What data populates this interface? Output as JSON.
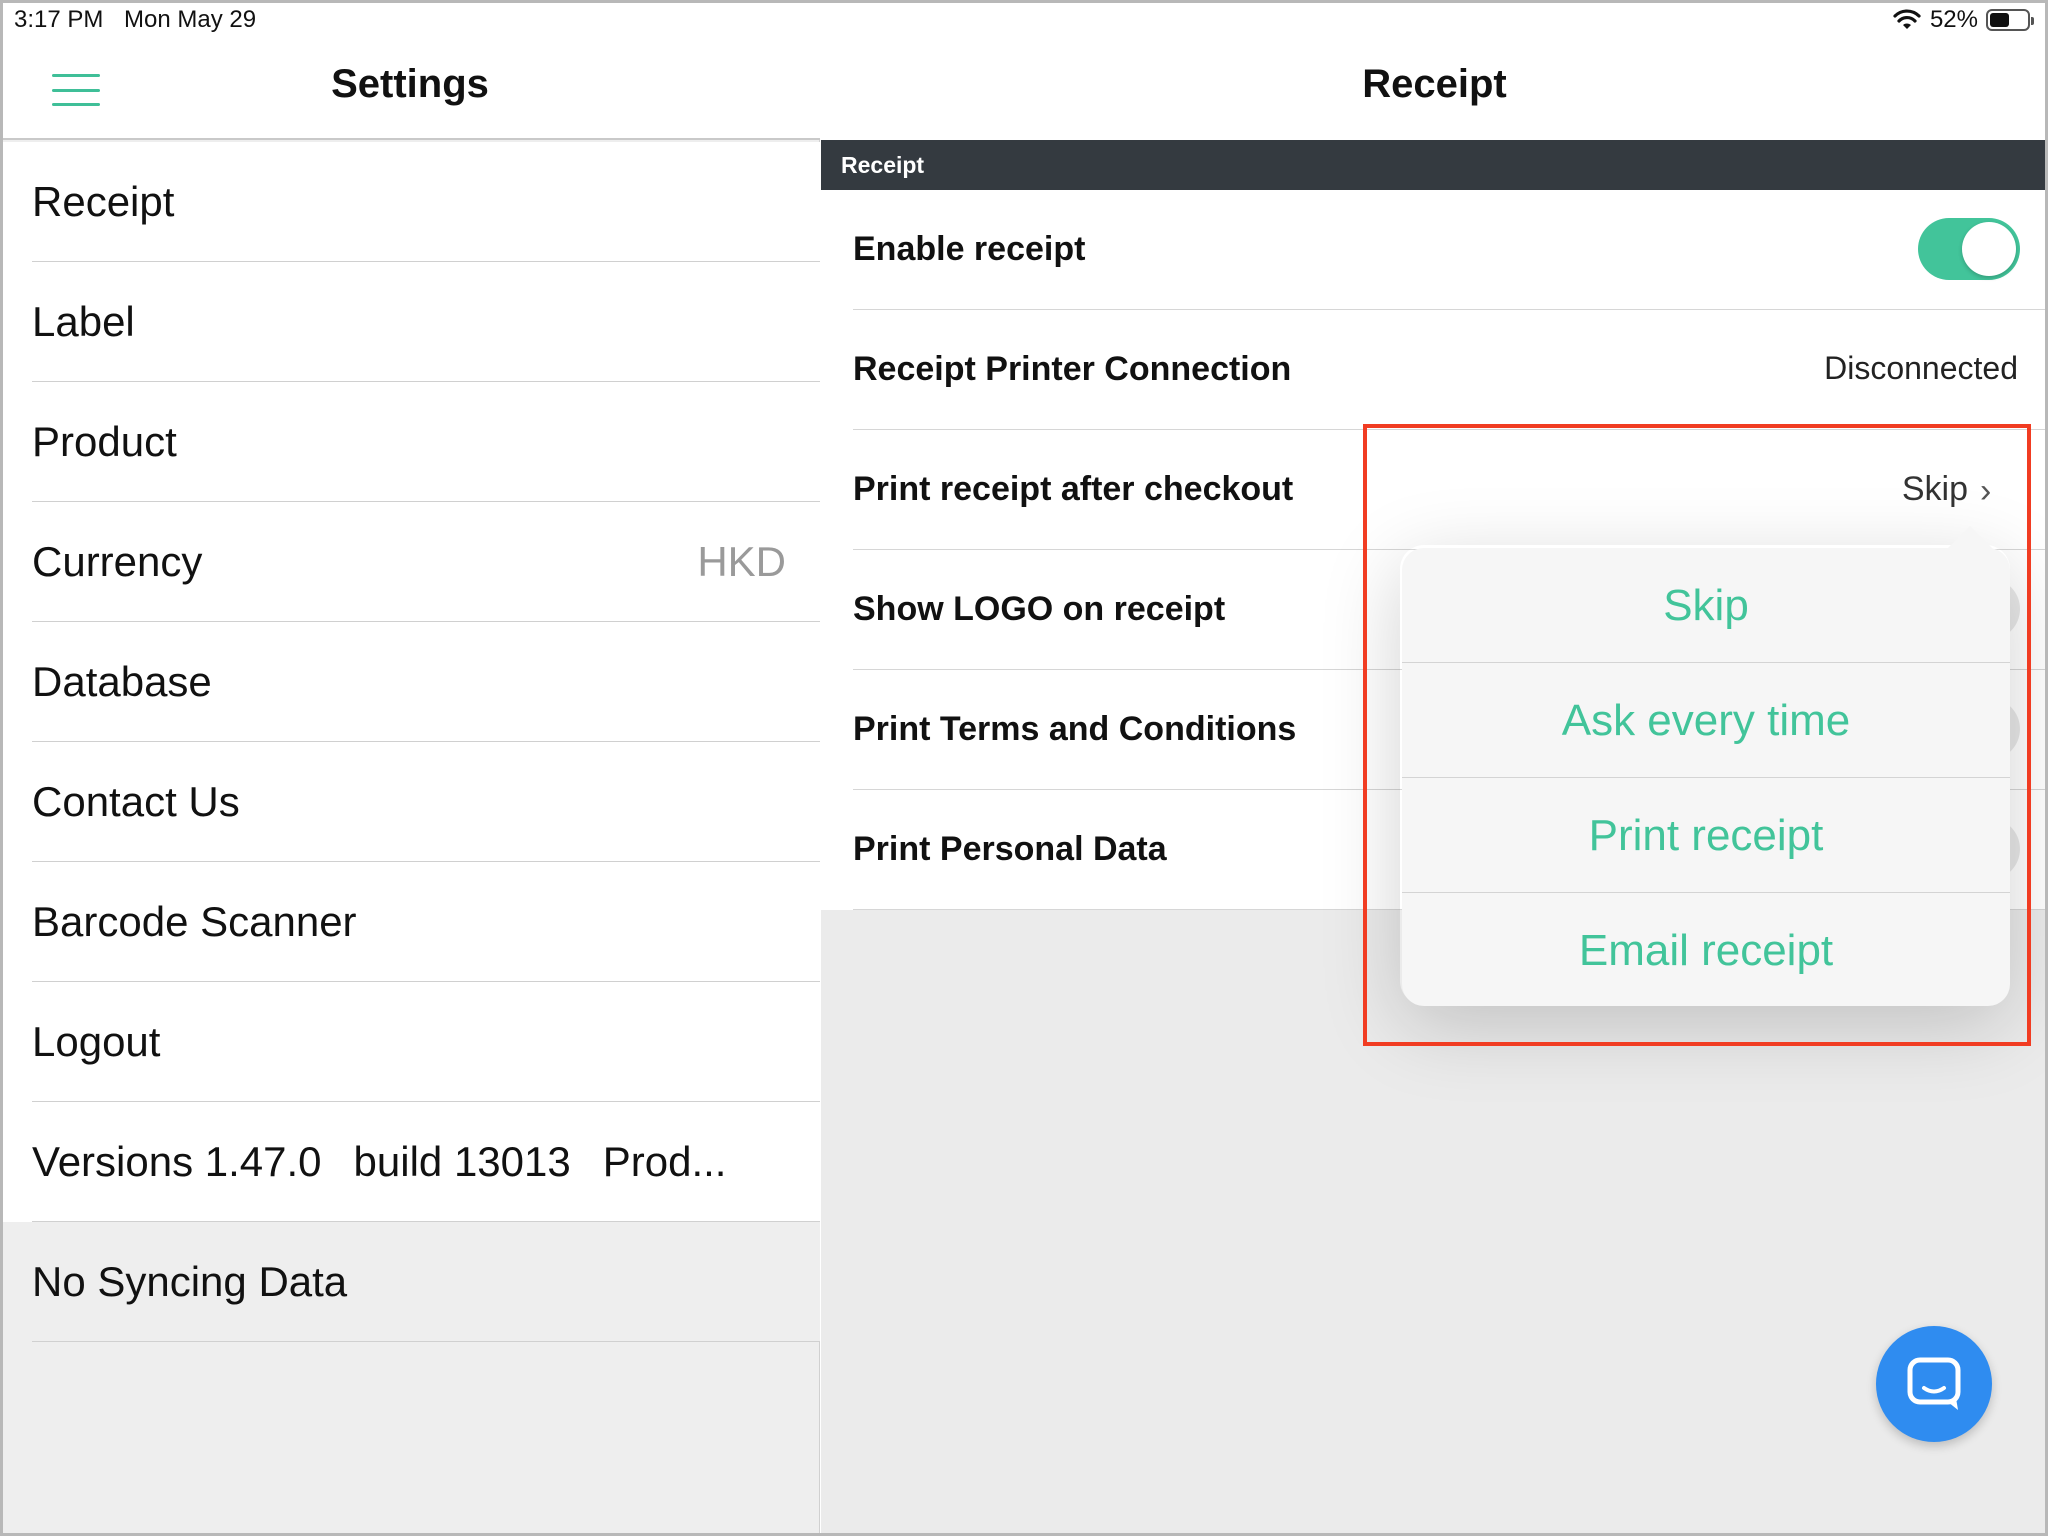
{
  "status_bar": {
    "time": "3:17 PM",
    "date": "Mon May 29",
    "battery": "52%",
    "battery_level": 0.52
  },
  "left": {
    "title": "Settings",
    "items": [
      {
        "label": "Receipt",
        "value": ""
      },
      {
        "label": "Label",
        "value": ""
      },
      {
        "label": "Product",
        "value": ""
      },
      {
        "label": "Currency",
        "value": "HKD"
      },
      {
        "label": "Database",
        "value": ""
      },
      {
        "label": "Contact Us",
        "value": ""
      },
      {
        "label": "Barcode Scanner",
        "value": ""
      },
      {
        "label": "Logout",
        "value": ""
      }
    ],
    "version": {
      "version": "Versions 1.47.0",
      "build": "build 13013",
      "env": "Prod..."
    },
    "sync_status": "No Syncing Data"
  },
  "right": {
    "title": "Receipt",
    "section": "Receipt",
    "rows": {
      "enable_receipt": {
        "label": "Enable receipt",
        "enabled": true
      },
      "printer_connection": {
        "label": "Receipt Printer Connection",
        "value": "Disconnected"
      },
      "print_after_checkout": {
        "label": "Print receipt after checkout",
        "value": "Skip"
      },
      "show_logo": {
        "label": "Show LOGO on receipt"
      },
      "print_terms": {
        "label": "Print Terms and Conditions"
      },
      "print_personal": {
        "label": "Print Personal Data"
      }
    },
    "popover_options": [
      "Skip",
      "Ask every time",
      "Print receipt",
      "Email receipt"
    ]
  },
  "colors": {
    "accent": "#42c49a",
    "section_bar": "#343a40",
    "highlight": "#f13c22",
    "chat_button": "#2f8cf0"
  }
}
